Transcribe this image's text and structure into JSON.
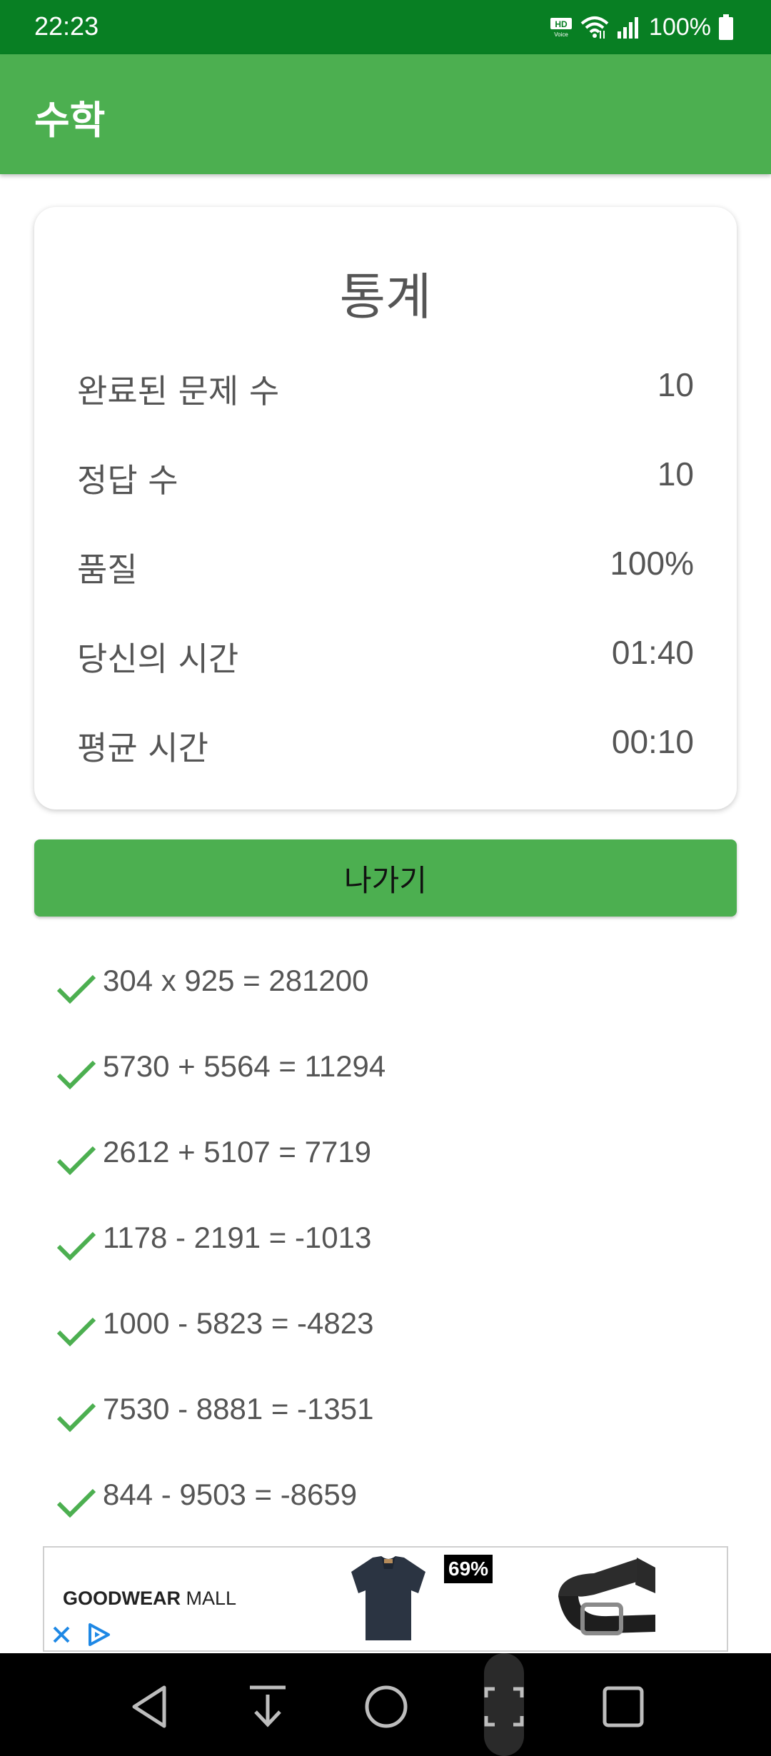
{
  "status_bar": {
    "time": "22:23",
    "battery": "100%",
    "background_color": "#087F23",
    "icons": [
      "hd-voice-icon",
      "wifi-icon",
      "signal-icon",
      "battery-icon"
    ]
  },
  "app_bar": {
    "title": "수학",
    "background_color": "#4CAF50"
  },
  "stats": {
    "title": "통계",
    "rows": [
      {
        "label": "완료된 문제 수",
        "value": "10"
      },
      {
        "label": "정답 수",
        "value": "10"
      },
      {
        "label": "품질",
        "value": "100%"
      },
      {
        "label": "당신의 시간",
        "value": "01:40"
      },
      {
        "label": "평균 시간",
        "value": "00:10"
      }
    ]
  },
  "exit_button": {
    "label": "나가기"
  },
  "results": [
    {
      "text": "304 x 925 = 281200",
      "correct": true
    },
    {
      "text": "5730 + 5564 = 11294",
      "correct": true
    },
    {
      "text": "2612 + 5107 = 7719",
      "correct": true
    },
    {
      "text": "1178 - 2191 = -1013",
      "correct": true
    },
    {
      "text": "1000 - 5823 = -4823",
      "correct": true
    },
    {
      "text": "7530 - 8881 = -1351",
      "correct": true
    },
    {
      "text": "844 - 9503 = -8659",
      "correct": true
    }
  ],
  "ad": {
    "brand_bold": "GOODWEAR",
    "brand_regular": " MALL",
    "discount": "69%"
  },
  "nav_bar": {
    "buttons": [
      "back-icon",
      "download-icon",
      "home-icon",
      "capture-icon",
      "recents-icon"
    ]
  }
}
